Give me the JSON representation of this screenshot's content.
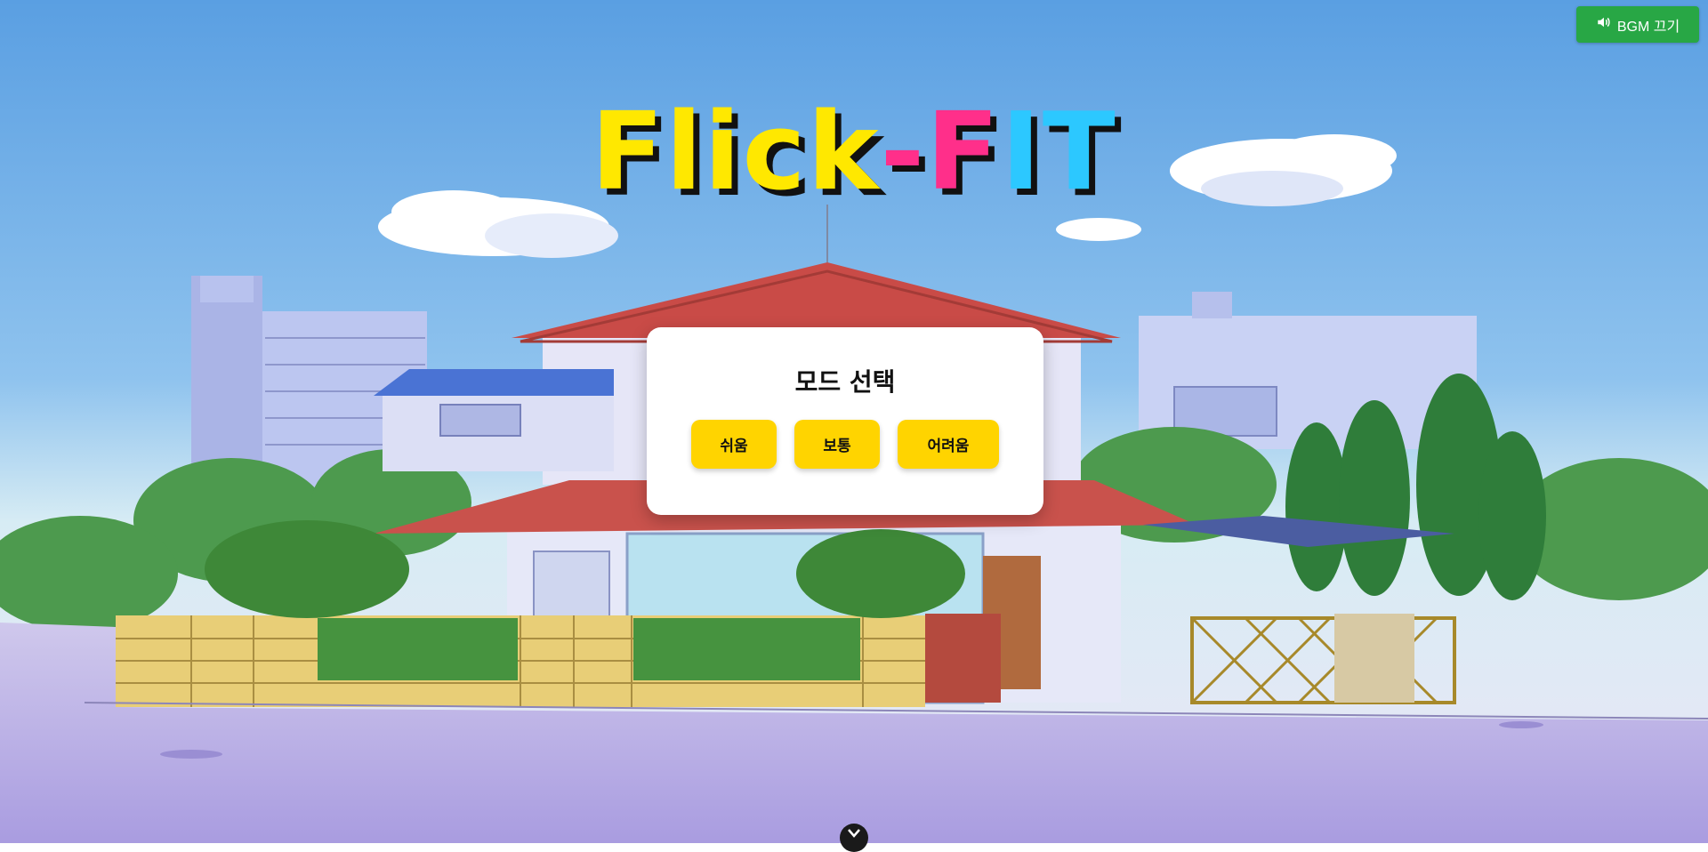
{
  "bgm_button": {
    "icon": "speaker-icon",
    "label": "BGM 끄기",
    "color": "#28a745"
  },
  "logo": {
    "part1": "Flick",
    "dash": "-",
    "part2": "F",
    "part3": "IT"
  },
  "mode_panel": {
    "title": "모드 선택",
    "buttons": [
      "쉬움",
      "보통",
      "어려움"
    ],
    "button_color": "#ffd400"
  },
  "scroll_handle": {
    "icon": "chevron-down-icon"
  }
}
